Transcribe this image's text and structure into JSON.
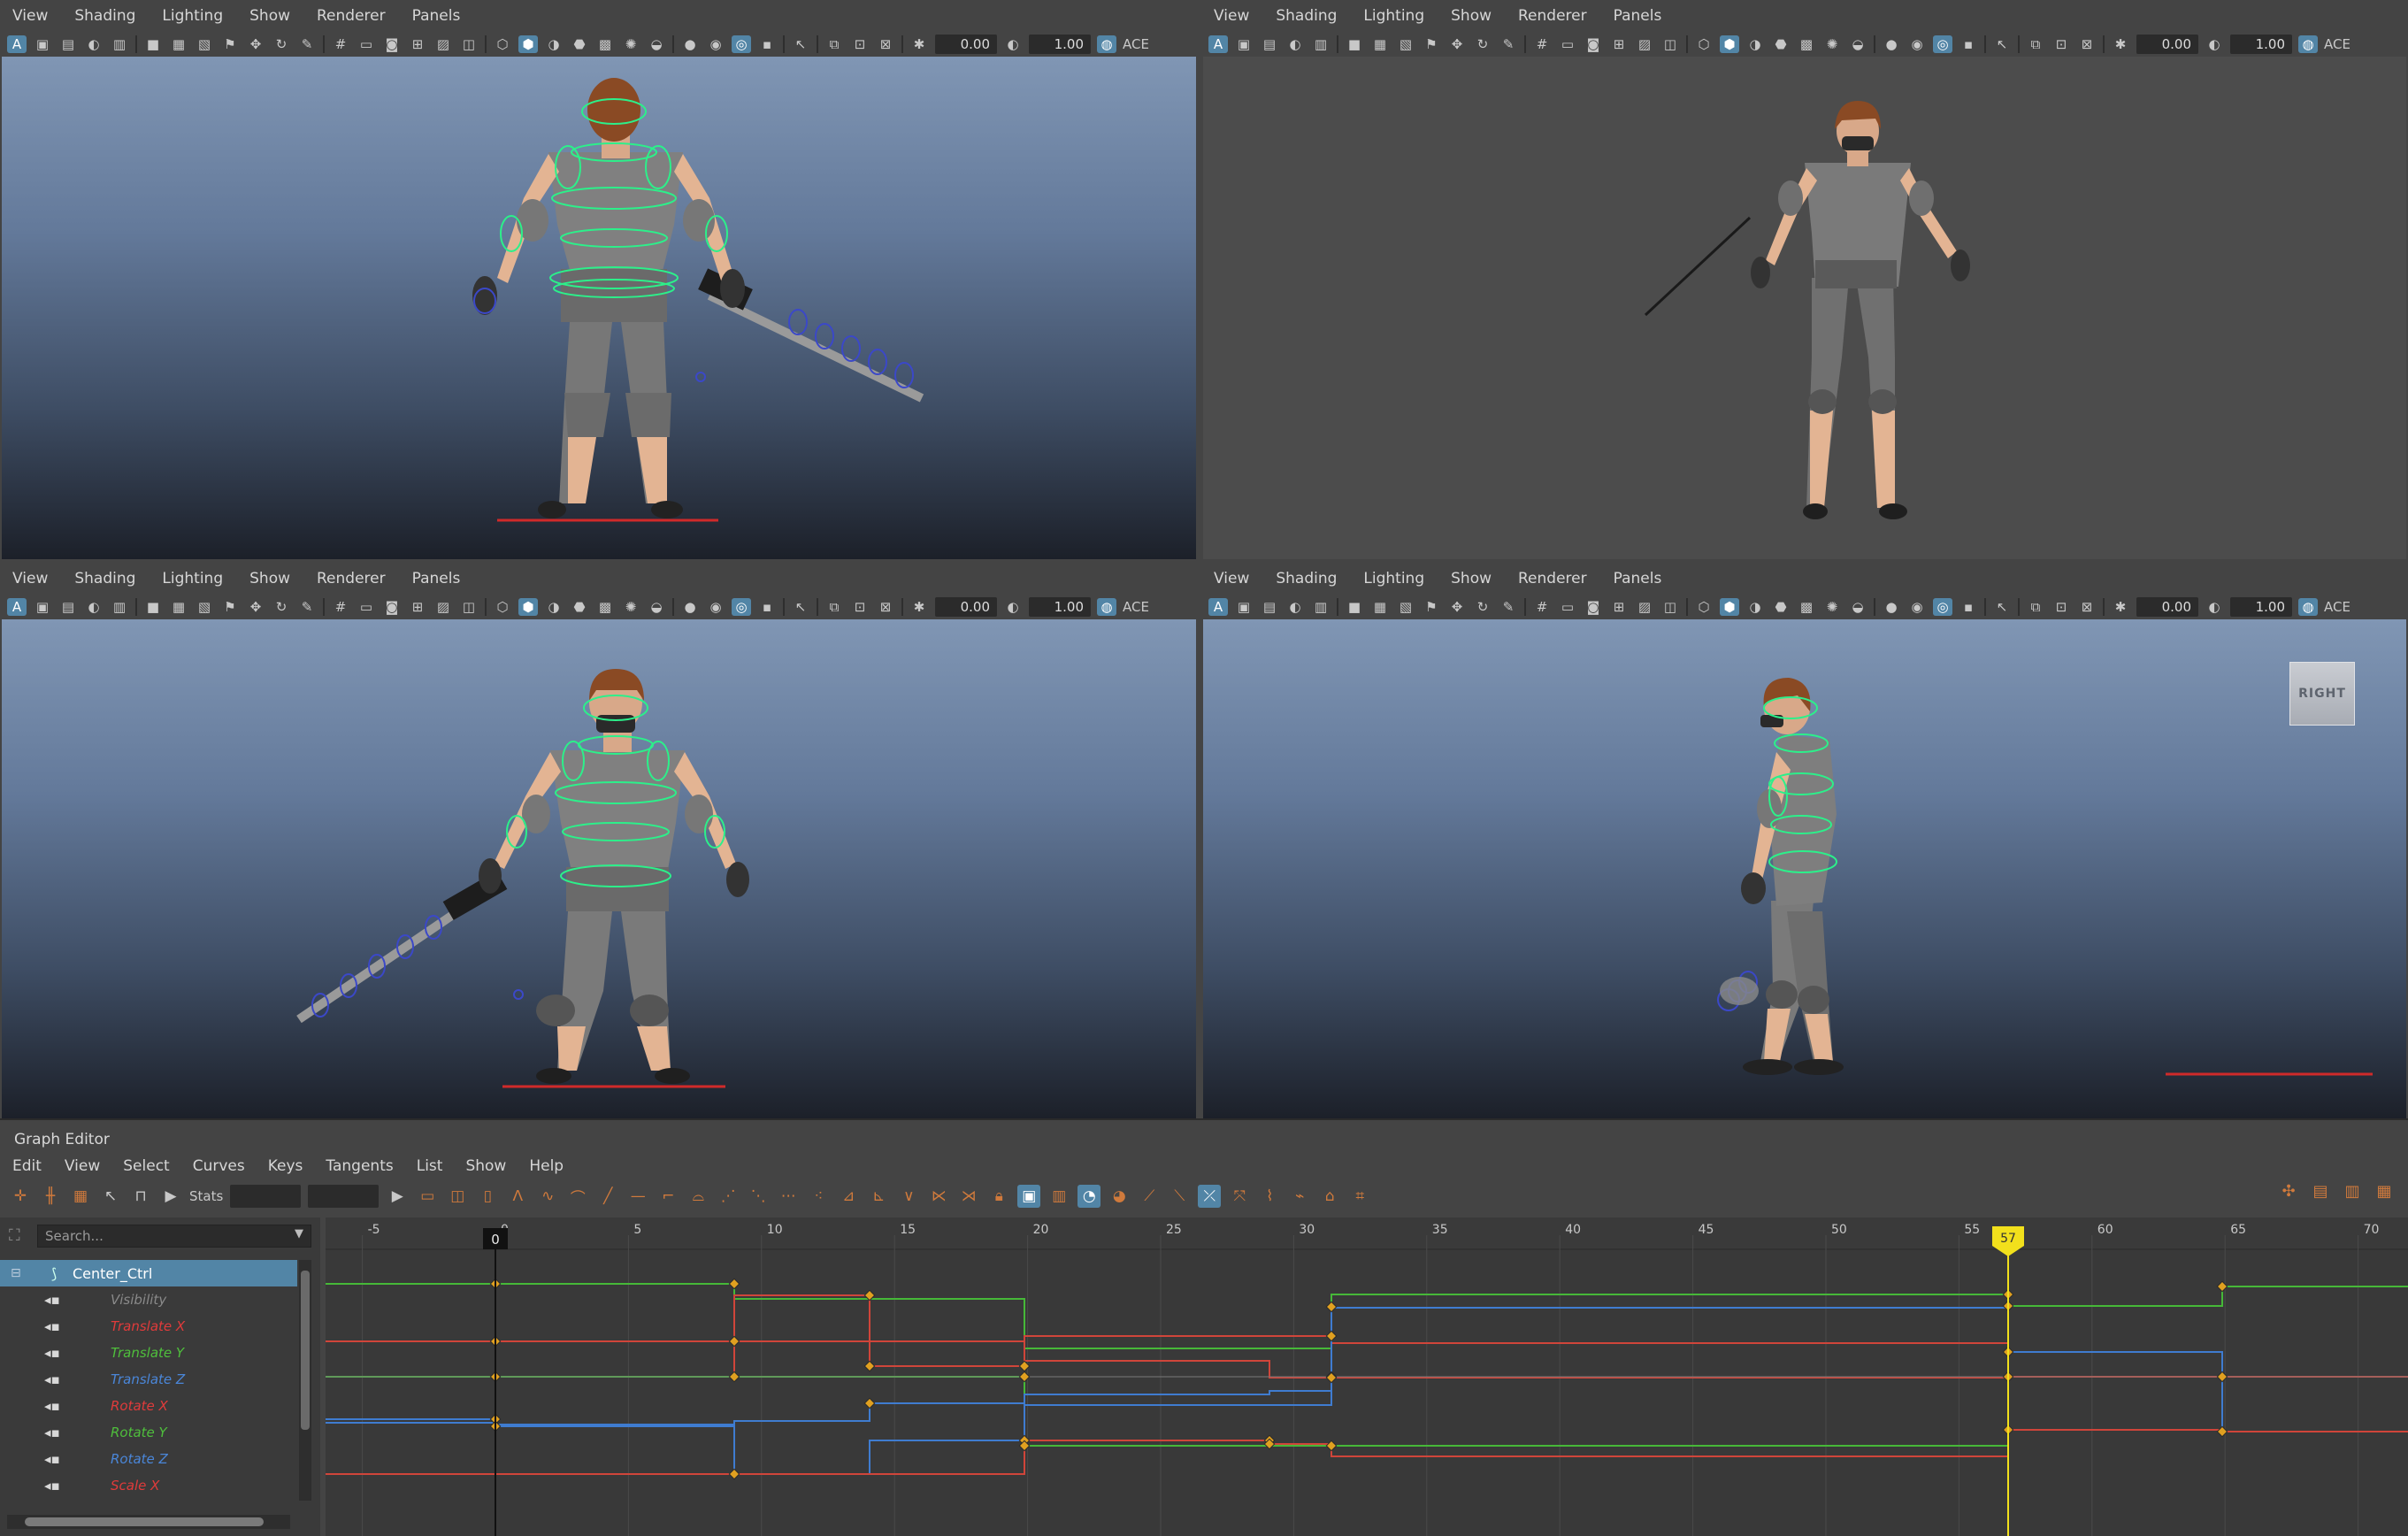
{
  "viewport_menu": [
    "View",
    "Shading",
    "Lighting",
    "Show",
    "Renderer",
    "Panels"
  ],
  "viewport_toolbar": {
    "exposure_value": "0.00",
    "gamma_value": "1.00",
    "color_space_label": "ACE"
  },
  "viewports": [
    {
      "name": "top-left",
      "background": "gradient"
    },
    {
      "name": "top-right",
      "background": "flat"
    },
    {
      "name": "bottom-left",
      "background": "gradient"
    },
    {
      "name": "bottom-right",
      "background": "gradient",
      "view_cube_label": "RIGHT"
    }
  ],
  "graph_editor": {
    "title": "Graph Editor",
    "menu": [
      "Edit",
      "View",
      "Select",
      "Curves",
      "Keys",
      "Tangents",
      "List",
      "Show",
      "Help"
    ],
    "stats_label": "Stats",
    "search_placeholder": "Search...",
    "node": "Center_Ctrl",
    "attributes": [
      {
        "label": "Visibility",
        "color": "#8a8a8a"
      },
      {
        "label": "Translate X",
        "color": "#e03b3b"
      },
      {
        "label": "Translate Y",
        "color": "#4fbf3c"
      },
      {
        "label": "Translate Z",
        "color": "#4a86d8"
      },
      {
        "label": "Rotate X",
        "color": "#e03b3b"
      },
      {
        "label": "Rotate Y",
        "color": "#4fbf3c"
      },
      {
        "label": "Rotate Z",
        "color": "#4a86d8"
      },
      {
        "label": "Scale X",
        "color": "#e03b3b"
      }
    ],
    "frame_ticks": [
      "-5",
      "0",
      "5",
      "10",
      "15",
      "20",
      "25",
      "30",
      "35",
      "40",
      "45",
      "50",
      "55",
      "60",
      "65",
      "70"
    ],
    "current_frame": "57",
    "start_marker": "0",
    "colors": {
      "accent": "#5285a6",
      "current_frame": "#f2e01c",
      "red_curve": "#d0453a",
      "green_curve": "#46b838",
      "blue_curve": "#3f7cd0",
      "key_point": "#e0a020"
    }
  }
}
